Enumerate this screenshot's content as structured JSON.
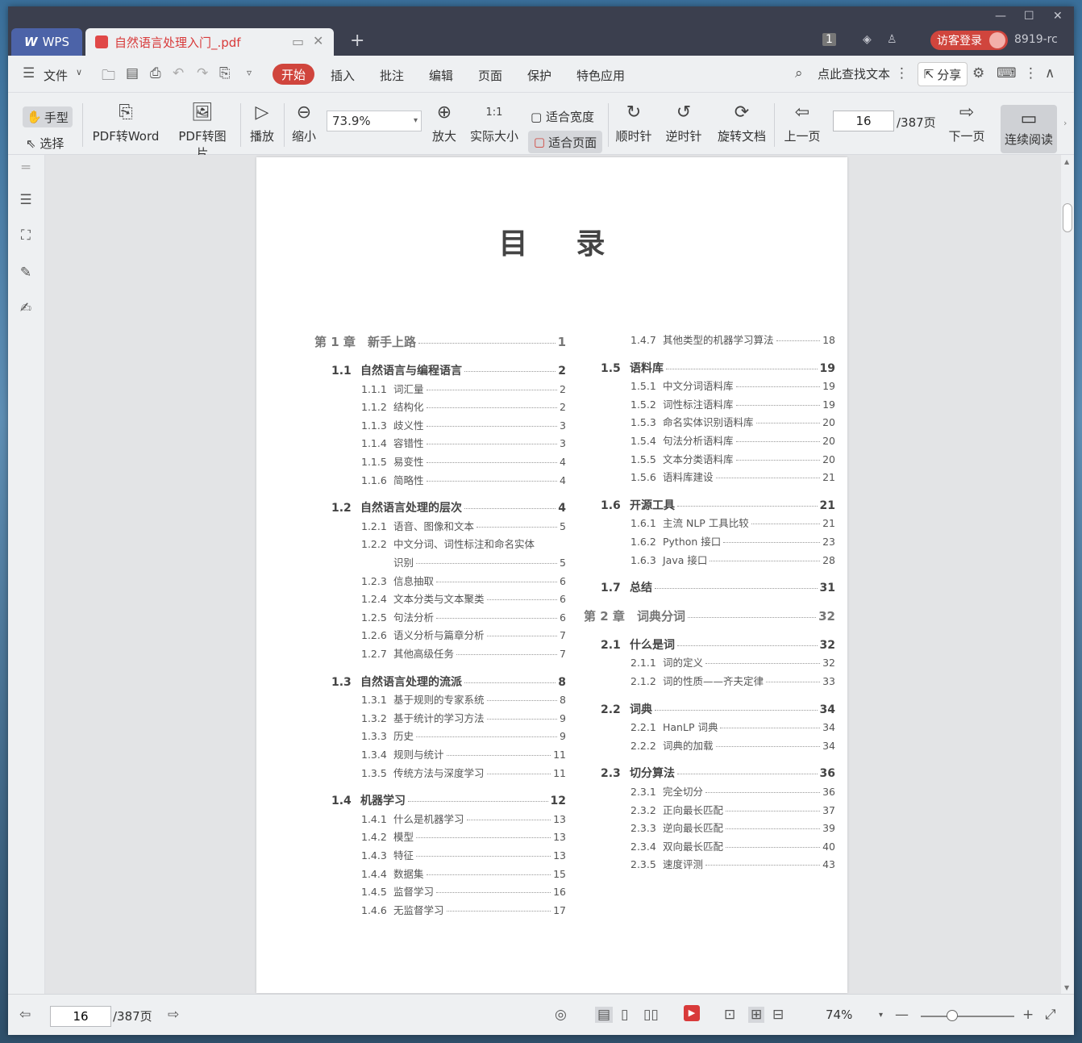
{
  "app": {
    "name": "WPS",
    "tab_title": "自然语言处理入门_.pdf",
    "new_tab": "+"
  },
  "titlebar": {
    "badge": "1",
    "login": "访客登录",
    "user": "8919-rc"
  },
  "menu": {
    "file": "文件",
    "active": "开始",
    "items": [
      "插入",
      "批注",
      "编辑",
      "页面",
      "保护",
      "特色应用"
    ],
    "search": "点此查找文本",
    "share": "分享"
  },
  "toolbar": {
    "hand": "手型",
    "select": "选择",
    "pdf_to_word": "PDF转Word",
    "pdf_to_image": "PDF转图片",
    "play": "播放",
    "zoom_out": "缩小",
    "zoom_value": "73.9%",
    "zoom_in": "放大",
    "actual_size": "实际大小",
    "fit_width": "适合宽度",
    "fit_page": "适合页面",
    "rotate_cw": "顺时针",
    "rotate_ccw": "逆时针",
    "rotate_doc": "旋转文档",
    "prev_page": "上一页",
    "page": "16",
    "total": "/387页",
    "next_page": "下一页",
    "continuous": "连续阅读"
  },
  "document": {
    "title": "目录",
    "left": [
      {
        "lvl": 0,
        "num": "第 1 章",
        "title": "新手上路",
        "page": "1"
      },
      {
        "lvl": 1,
        "num": "1.1",
        "title": "自然语言与编程语言",
        "page": "2"
      },
      {
        "lvl": 2,
        "num": "1.1.1",
        "title": "词汇量",
        "page": "2"
      },
      {
        "lvl": 2,
        "num": "1.1.2",
        "title": "结构化",
        "page": "2"
      },
      {
        "lvl": 2,
        "num": "1.1.3",
        "title": "歧义性",
        "page": "3"
      },
      {
        "lvl": 2,
        "num": "1.1.4",
        "title": "容错性",
        "page": "3"
      },
      {
        "lvl": 2,
        "num": "1.1.5",
        "title": "易变性",
        "page": "4"
      },
      {
        "lvl": 2,
        "num": "1.1.6",
        "title": "简略性",
        "page": "4"
      },
      {
        "lvl": 1,
        "num": "1.2",
        "title": "自然语言处理的层次",
        "page": "4"
      },
      {
        "lvl": 2,
        "num": "1.2.1",
        "title": "语音、图像和文本",
        "page": "5"
      },
      {
        "lvl": 2,
        "num": "1.2.2",
        "title": "中文分词、词性标注和命名实体",
        "page": ""
      },
      {
        "lvl": 2,
        "num": "",
        "title": "识别",
        "page": "5"
      },
      {
        "lvl": 2,
        "num": "1.2.3",
        "title": "信息抽取",
        "page": "6"
      },
      {
        "lvl": 2,
        "num": "1.2.4",
        "title": "文本分类与文本聚类",
        "page": "6"
      },
      {
        "lvl": 2,
        "num": "1.2.5",
        "title": "句法分析",
        "page": "6"
      },
      {
        "lvl": 2,
        "num": "1.2.6",
        "title": "语义分析与篇章分析",
        "page": "7"
      },
      {
        "lvl": 2,
        "num": "1.2.7",
        "title": "其他高级任务",
        "page": "7"
      },
      {
        "lvl": 1,
        "num": "1.3",
        "title": "自然语言处理的流派",
        "page": "8"
      },
      {
        "lvl": 2,
        "num": "1.3.1",
        "title": "基于规则的专家系统",
        "page": "8"
      },
      {
        "lvl": 2,
        "num": "1.3.2",
        "title": "基于统计的学习方法",
        "page": "9"
      },
      {
        "lvl": 2,
        "num": "1.3.3",
        "title": "历史",
        "page": "9"
      },
      {
        "lvl": 2,
        "num": "1.3.4",
        "title": "规则与统计",
        "page": "11"
      },
      {
        "lvl": 2,
        "num": "1.3.5",
        "title": "传统方法与深度学习",
        "page": "11"
      },
      {
        "lvl": 1,
        "num": "1.4",
        "title": "机器学习",
        "page": "12"
      },
      {
        "lvl": 2,
        "num": "1.4.1",
        "title": "什么是机器学习",
        "page": "13"
      },
      {
        "lvl": 2,
        "num": "1.4.2",
        "title": "模型",
        "page": "13"
      },
      {
        "lvl": 2,
        "num": "1.4.3",
        "title": "特征",
        "page": "13"
      },
      {
        "lvl": 2,
        "num": "1.4.4",
        "title": "数据集",
        "page": "15"
      },
      {
        "lvl": 2,
        "num": "1.4.5",
        "title": "监督学习",
        "page": "16"
      },
      {
        "lvl": 2,
        "num": "1.4.6",
        "title": "无监督学习",
        "page": "17"
      }
    ],
    "right": [
      {
        "lvl": 2,
        "num": "1.4.7",
        "title": "其他类型的机器学习算法",
        "page": "18"
      },
      {
        "lvl": 1,
        "num": "1.5",
        "title": "语料库",
        "page": "19"
      },
      {
        "lvl": 2,
        "num": "1.5.1",
        "title": "中文分词语料库",
        "page": "19"
      },
      {
        "lvl": 2,
        "num": "1.5.2",
        "title": "词性标注语料库",
        "page": "19"
      },
      {
        "lvl": 2,
        "num": "1.5.3",
        "title": "命名实体识别语料库",
        "page": "20"
      },
      {
        "lvl": 2,
        "num": "1.5.4",
        "title": "句法分析语料库",
        "page": "20"
      },
      {
        "lvl": 2,
        "num": "1.5.5",
        "title": "文本分类语料库",
        "page": "20"
      },
      {
        "lvl": 2,
        "num": "1.5.6",
        "title": "语料库建设",
        "page": "21"
      },
      {
        "lvl": 1,
        "num": "1.6",
        "title": "开源工具",
        "page": "21"
      },
      {
        "lvl": 2,
        "num": "1.6.1",
        "title": "主流 NLP 工具比较",
        "page": "21"
      },
      {
        "lvl": 2,
        "num": "1.6.2",
        "title": "Python 接口",
        "page": "23"
      },
      {
        "lvl": 2,
        "num": "1.6.3",
        "title": "Java 接口",
        "page": "28"
      },
      {
        "lvl": 1,
        "num": "1.7",
        "title": "总结",
        "page": "31"
      },
      {
        "lvl": 0,
        "num": "第 2 章",
        "title": "词典分词",
        "page": "32"
      },
      {
        "lvl": 1,
        "num": "2.1",
        "title": "什么是词",
        "page": "32"
      },
      {
        "lvl": 2,
        "num": "2.1.1",
        "title": "词的定义",
        "page": "32"
      },
      {
        "lvl": 2,
        "num": "2.1.2",
        "title": "词的性质——齐夫定律",
        "page": "33"
      },
      {
        "lvl": 1,
        "num": "2.2",
        "title": "词典",
        "page": "34"
      },
      {
        "lvl": 2,
        "num": "2.2.1",
        "title": "HanLP 词典",
        "page": "34"
      },
      {
        "lvl": 2,
        "num": "2.2.2",
        "title": "词典的加载",
        "page": "34"
      },
      {
        "lvl": 1,
        "num": "2.3",
        "title": "切分算法",
        "page": "36"
      },
      {
        "lvl": 2,
        "num": "2.3.1",
        "title": "完全切分",
        "page": "36"
      },
      {
        "lvl": 2,
        "num": "2.3.2",
        "title": "正向最长匹配",
        "page": "37"
      },
      {
        "lvl": 2,
        "num": "2.3.3",
        "title": "逆向最长匹配",
        "page": "39"
      },
      {
        "lvl": 2,
        "num": "2.3.4",
        "title": "双向最长匹配",
        "page": "40"
      },
      {
        "lvl": 2,
        "num": "2.3.5",
        "title": "速度评测",
        "page": "43"
      }
    ]
  },
  "statusbar": {
    "page": "16",
    "total": "/387页",
    "zoom": "74%"
  },
  "colors": {
    "accent": "#d0453d",
    "titlebar": "#3b3f4e",
    "wps_tab": "#4c63a8"
  }
}
